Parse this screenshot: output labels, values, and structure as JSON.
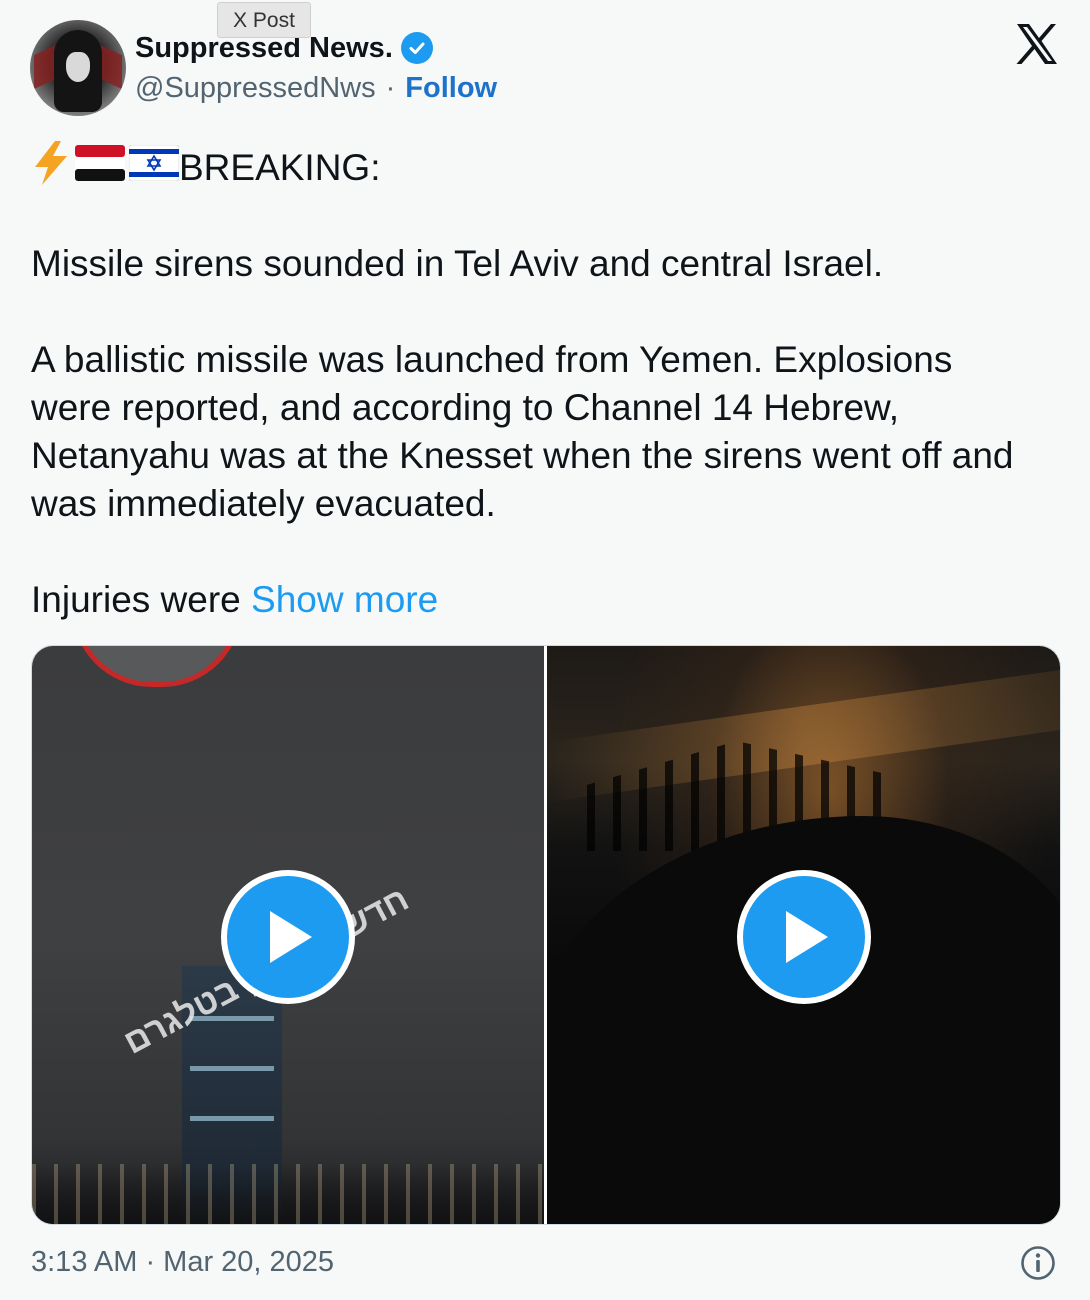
{
  "tooltip": {
    "label": "X Post"
  },
  "author": {
    "display_name": "Suppressed News.",
    "handle": "@SuppressedNws",
    "separator": "·",
    "follow_label": "Follow",
    "verified": true
  },
  "tweet": {
    "flags": [
      "high-voltage-emoji",
      "yemen-flag",
      "israel-flag"
    ],
    "headline": "BREAKING:",
    "paragraph1": "Missile sirens sounded in Tel Aviv and central Israel.",
    "paragraph2": "A ballistic missile was launched from Yemen. Explosions were reported, and according to Channel 14 Hebrew, Netanyahu was at the Knesset when the sirens went off and was immediately evacuated.",
    "paragraph3_start": "Injuries were",
    "show_more_label": "Show more"
  },
  "media": {
    "videos": [
      {
        "watermark": "חדשות בזמן בטלגרם"
      },
      {
        "watermark": ""
      }
    ]
  },
  "footer": {
    "timestamp": "3:13 AM · Mar 20, 2025"
  },
  "colors": {
    "accent": "#1d9bf0",
    "follow": "#1d72c9",
    "text": "#0f1419",
    "muted": "#536471",
    "background": "#f7f9f9"
  }
}
